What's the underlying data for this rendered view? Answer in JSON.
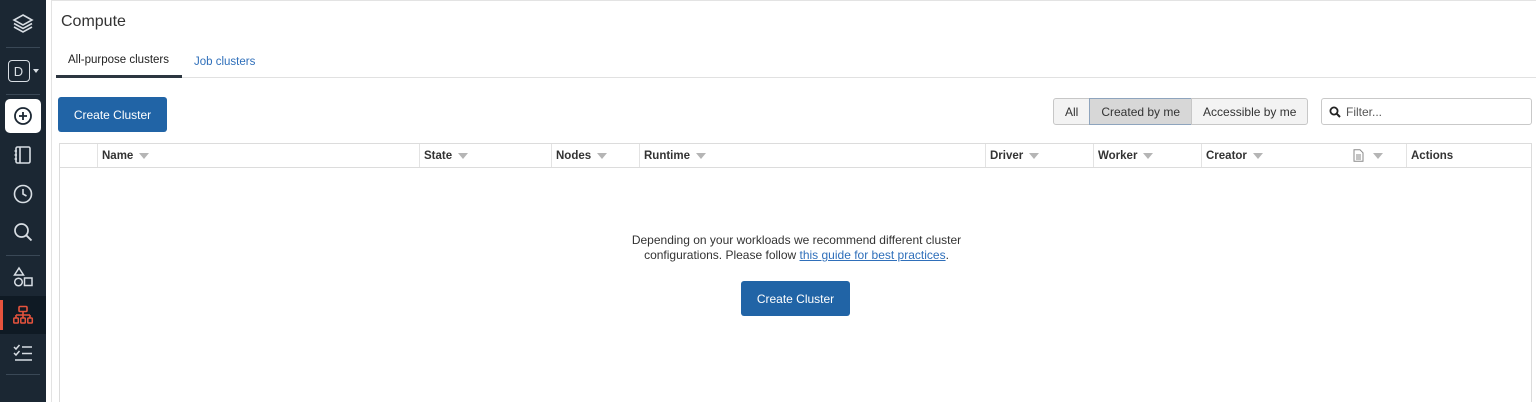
{
  "sidebar": {
    "items": [
      {
        "name": "layers-icon"
      },
      {
        "name": "workspace-switcher",
        "label": "D"
      },
      {
        "name": "create-icon"
      },
      {
        "name": "notebook-icon"
      },
      {
        "name": "recents-clock-icon"
      },
      {
        "name": "search-icon"
      },
      {
        "name": "data-shapes-icon"
      },
      {
        "name": "compute-icon"
      },
      {
        "name": "workflows-icon"
      }
    ],
    "active_color": "#e5533d",
    "background": "#1b2733"
  },
  "header": {
    "title": "Compute"
  },
  "tabs": [
    {
      "label": "All-purpose clusters",
      "active": true
    },
    {
      "label": "Job clusters",
      "active": false
    }
  ],
  "toolbar": {
    "create_label": "Create Cluster",
    "filter_options": [
      {
        "label": "All",
        "selected": false
      },
      {
        "label": "Created by me",
        "selected": true
      },
      {
        "label": "Accessible by me",
        "selected": false
      }
    ],
    "filter_placeholder": "Filter..."
  },
  "table": {
    "columns": [
      "Name",
      "State",
      "Nodes",
      "Runtime",
      "Driver",
      "Worker",
      "Creator",
      "",
      "Actions"
    ],
    "rows": []
  },
  "empty_state": {
    "line1": "Depending on your workloads we recommend different cluster",
    "line2_prefix": "configurations. Please follow ",
    "link_text": "this guide for best practices",
    "line2_suffix": ".",
    "button_label": "Create Cluster"
  },
  "colors": {
    "primary": "#2164a6",
    "link": "#2f6fba"
  }
}
